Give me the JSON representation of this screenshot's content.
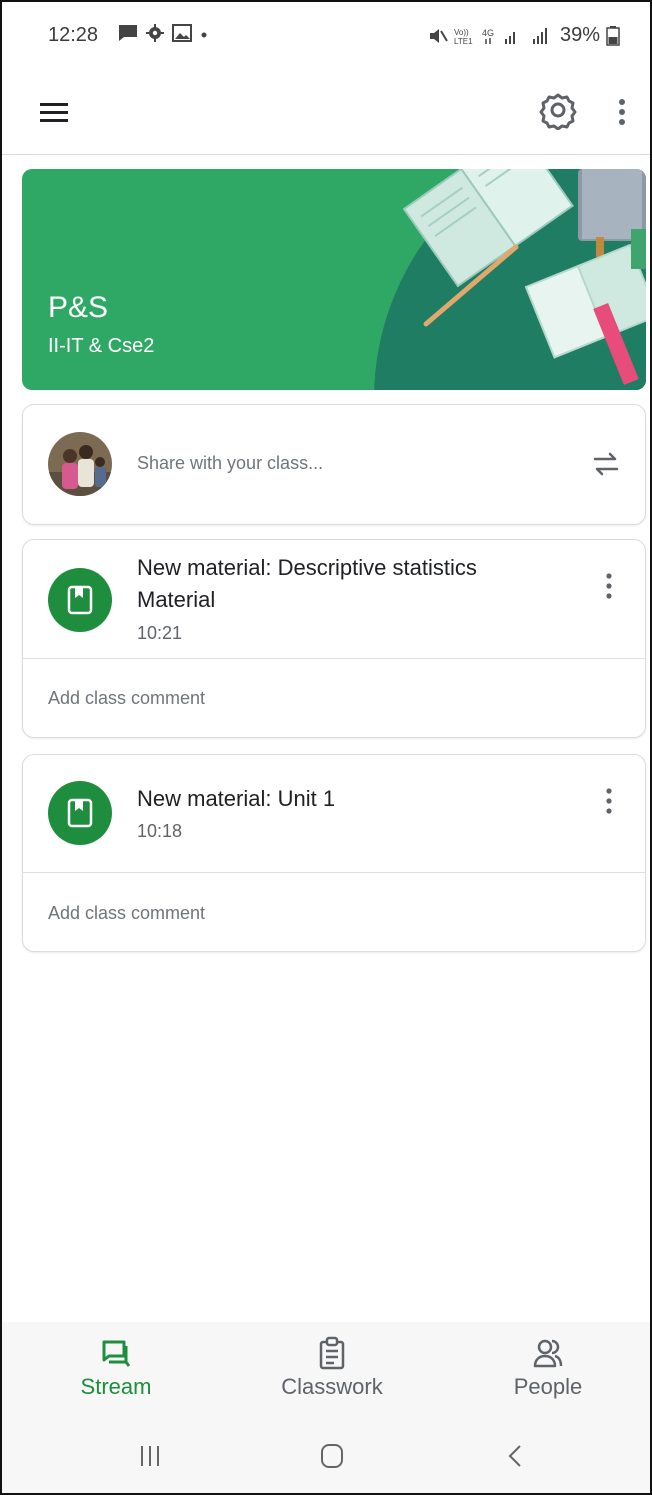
{
  "status_bar": {
    "time": "12:28",
    "battery": "39%"
  },
  "class": {
    "name": "P&S",
    "section": "II-IT & Cse2",
    "theme_color": "#2fa866"
  },
  "share": {
    "placeholder": "Share with your class..."
  },
  "posts": [
    {
      "title": "New material: Descriptive statistics Material",
      "time": "10:21",
      "comment_label": "Add class comment",
      "icon": "material-book-icon"
    },
    {
      "title": "New material: Unit 1",
      "time": "10:18",
      "comment_label": "Add class comment",
      "icon": "material-book-icon"
    }
  ],
  "bottom_nav": {
    "items": [
      {
        "label": "Stream",
        "icon": "stream-icon",
        "active": true
      },
      {
        "label": "Classwork",
        "icon": "classwork-icon",
        "active": false
      },
      {
        "label": "People",
        "icon": "people-icon",
        "active": false
      }
    ],
    "active_color": "#1e8e3e",
    "inactive_color": "#5f6368"
  }
}
